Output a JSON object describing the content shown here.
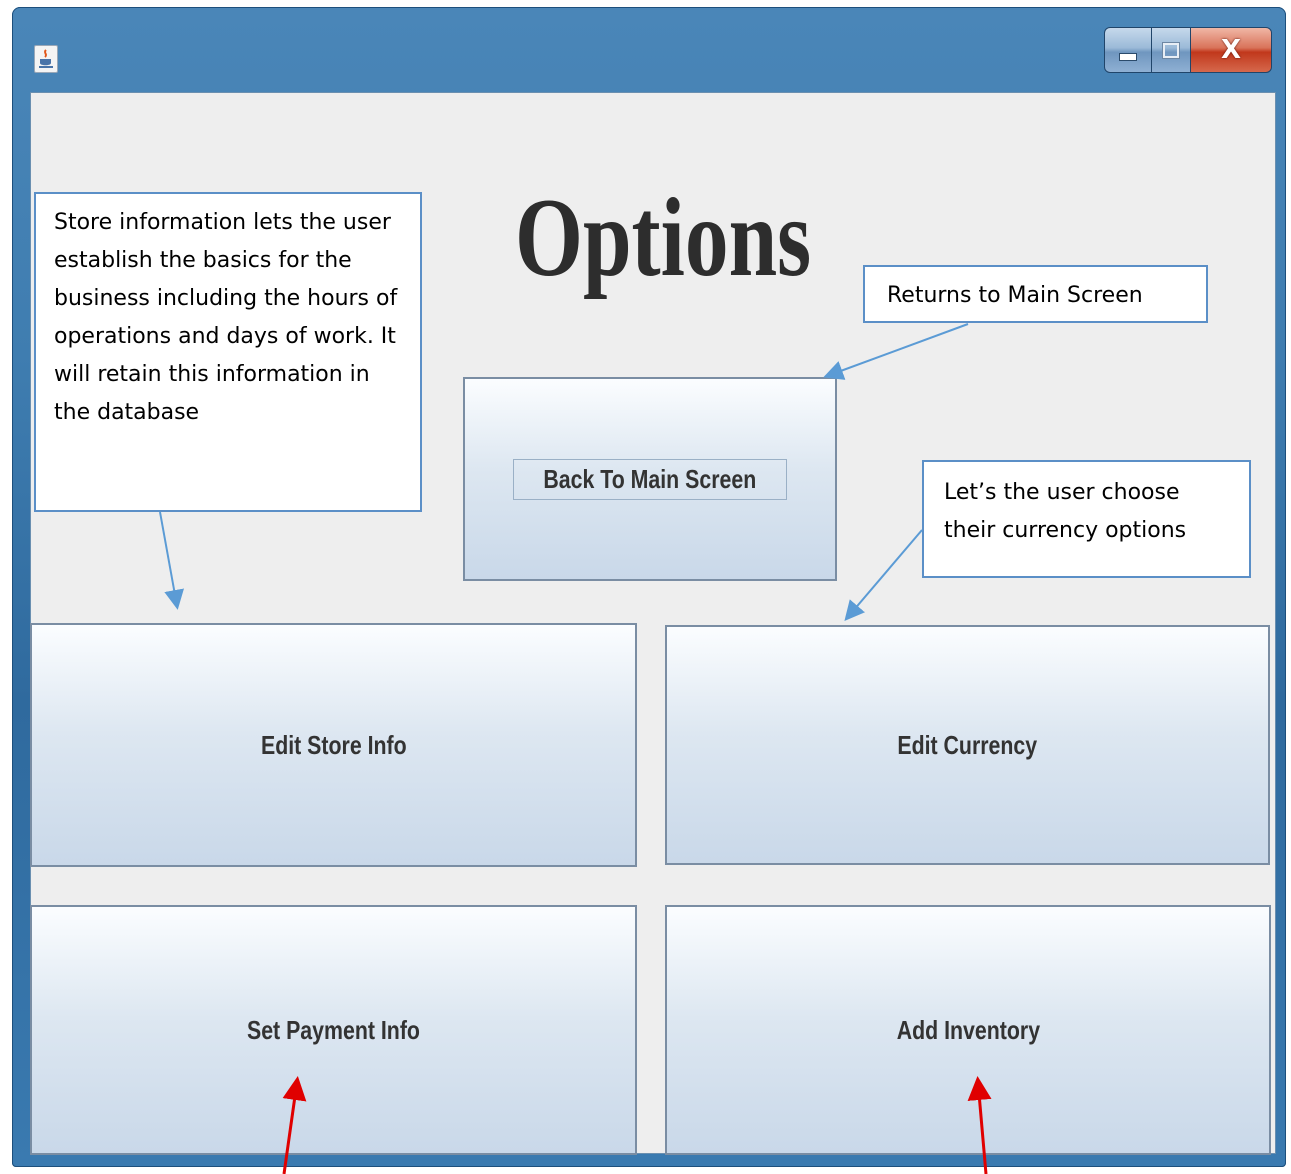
{
  "window": {
    "title_text": "",
    "app_icon": "java-cup-icon",
    "controls": {
      "minimize": "minimize-icon",
      "maximize": "maximize-icon",
      "close": "X"
    }
  },
  "main": {
    "heading": "Options",
    "buttons": {
      "back": "Back To Main Screen",
      "edit_store": "Edit Store Info",
      "edit_currency": "Edit Currency",
      "set_payment": "Set Payment Info",
      "add_inventory": "Add Inventory"
    }
  },
  "annotations": {
    "store_info": "Store information lets the user establish the basics for the business including the hours of operations and days of work. It will retain this information in the database",
    "returns": "Returns to Main Screen",
    "currency": "Let’s the user choose their currency options"
  },
  "colors": {
    "annotation_arrow": "#5b9bd5",
    "highlight_arrow": "#e00000"
  }
}
